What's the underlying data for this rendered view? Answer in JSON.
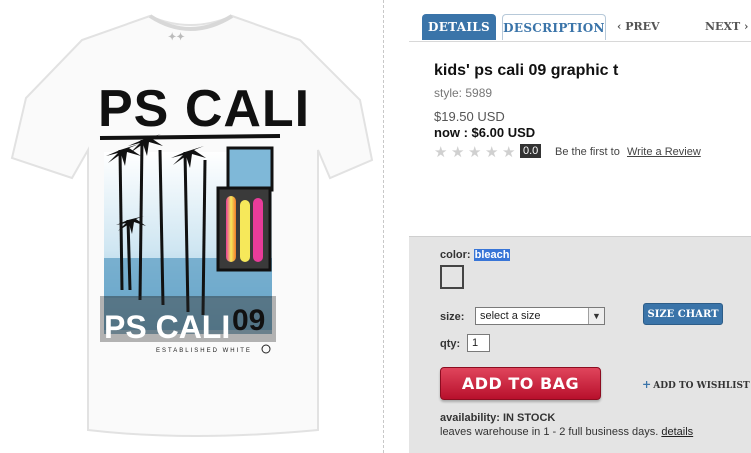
{
  "tabs": {
    "details": "DETAILS",
    "description": "DESCRIPTION",
    "prev": "PREV",
    "next": "NEXT"
  },
  "product": {
    "title": "kids' ps cali 09 graphic t",
    "style": "style: 5989",
    "price_original": "$19.50 USD",
    "price_now": "now : $6.00 USD",
    "rating_value": "0.0",
    "be_first": "Be the first to",
    "write_review": "Write a Review"
  },
  "graphic": {
    "headline": "PS CALI",
    "bottom_text": "PS CALI",
    "number": "09",
    "small_text": "ESTABLISHED WHITE"
  },
  "options": {
    "color_label": "color:",
    "color_value": "bleach",
    "size_label": "size:",
    "size_placeholder": "select a size",
    "size_chart": "SIZE CHART",
    "qty_label": "qty:",
    "qty_value": "1",
    "add_to_bag": "ADD TO BAG",
    "wishlist": "ADD TO WISHLIST",
    "availability": "availability: IN STOCK",
    "warehouse": "leaves warehouse in 1 - 2 full business days.",
    "details_link": "details"
  },
  "icons": {
    "prev": "chevron-left-icon",
    "next": "chevron-right-icon",
    "dropdown": "chevron-down-icon",
    "plus": "plus-icon",
    "star": "star-icon"
  },
  "colors": {
    "tab_blue": "#3a74a9",
    "add_to_bag_red": "#c8213a",
    "panel_gray": "#e4e4e4"
  }
}
